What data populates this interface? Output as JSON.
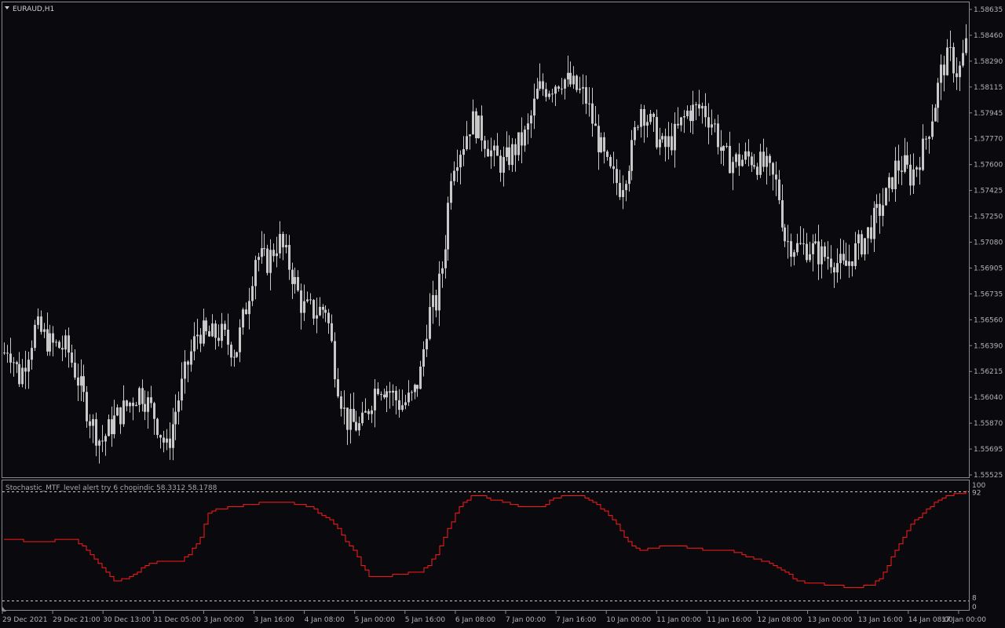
{
  "window": {
    "title": "EURAUD,H1"
  },
  "indicator": {
    "label": "Stochastic_MTF_level alert try 6 chopindic 58.3312 58.1788",
    "levels": [
      {
        "label": "100",
        "value": 100
      },
      {
        "label": "92",
        "value": 92
      },
      {
        "label": "8",
        "value": 8
      },
      {
        "label": "0",
        "value": 0
      }
    ],
    "line_color": "#ff1a1a"
  },
  "colors": {
    "background": "#0a0a0e",
    "candles": "#c8c8c8",
    "grid_frame": "#8a8a8a",
    "axis_text": "#b4b4b4"
  },
  "chart_data": {
    "type": "candlestick",
    "symbol": "EURAUD",
    "timeframe": "H1",
    "ylim": [
      1.5552,
      1.5868
    ],
    "price_ticks": [
      "1.58635",
      "1.58460",
      "1.58290",
      "1.58115",
      "1.57945",
      "1.57770",
      "1.57600",
      "1.57425",
      "1.57250",
      "1.57080",
      "1.56905",
      "1.56735",
      "1.56560",
      "1.56390",
      "1.56215",
      "1.56040",
      "1.55870",
      "1.55695",
      "1.55525"
    ],
    "time_ticks": [
      "29 Dec 2021",
      "29 Dec 21:00",
      "30 Dec 13:00",
      "31 Dec 05:00",
      "3 Jan 00:00",
      "3 Jan 16:00",
      "4 Jan 08:00",
      "5 Jan 00:00",
      "5 Jan 16:00",
      "6 Jan 08:00",
      "7 Jan 00:00",
      "7 Jan 16:00",
      "10 Jan 00:00",
      "11 Jan 00:00",
      "11 Jan 16:00",
      "12 Jan 08:00",
      "13 Jan 00:00",
      "13 Jan 16:00",
      "14 Jan 08:00",
      "17 Jan 00:00"
    ],
    "price_path": [
      [
        0,
        1.563
      ],
      [
        10,
        1.564
      ],
      [
        25,
        1.5618
      ],
      [
        45,
        1.5652
      ],
      [
        65,
        1.564
      ],
      [
        85,
        1.5638
      ],
      [
        100,
        1.5615
      ],
      [
        115,
        1.559
      ],
      [
        128,
        1.5575
      ],
      [
        145,
        1.559
      ],
      [
        162,
        1.56
      ],
      [
        178,
        1.561
      ],
      [
        195,
        1.5595
      ],
      [
        212,
        1.557
      ],
      [
        225,
        1.56
      ],
      [
        240,
        1.563
      ],
      [
        252,
        1.565
      ],
      [
        265,
        1.5645
      ],
      [
        280,
        1.5648
      ],
      [
        300,
        1.5635
      ],
      [
        315,
        1.567
      ],
      [
        325,
        1.57
      ],
      [
        340,
        1.5695
      ],
      [
        355,
        1.571
      ],
      [
        370,
        1.569
      ],
      [
        385,
        1.5665
      ],
      [
        400,
        1.5662
      ],
      [
        415,
        1.5665
      ],
      [
        428,
        1.562
      ],
      [
        440,
        1.559
      ],
      [
        460,
        1.5585
      ],
      [
        480,
        1.5615
      ],
      [
        495,
        1.561
      ],
      [
        510,
        1.56
      ],
      [
        525,
        1.5605
      ],
      [
        535,
        1.562
      ],
      [
        545,
        1.566
      ],
      [
        555,
        1.5668
      ],
      [
        565,
        1.57
      ],
      [
        575,
        1.576
      ],
      [
        590,
        1.5775
      ],
      [
        600,
        1.579
      ],
      [
        615,
        1.578
      ],
      [
        628,
        1.5765
      ],
      [
        640,
        1.576
      ],
      [
        655,
        1.577
      ],
      [
        670,
        1.578
      ],
      [
        685,
        1.581
      ],
      [
        700,
        1.5812
      ],
      [
        715,
        1.5818
      ],
      [
        730,
        1.5812
      ],
      [
        745,
        1.5805
      ],
      [
        760,
        1.5778
      ],
      [
        775,
        1.5755
      ],
      [
        790,
        1.5745
      ],
      [
        805,
        1.577
      ],
      [
        815,
        1.58
      ],
      [
        830,
        1.5785
      ],
      [
        845,
        1.577
      ],
      [
        860,
        1.578
      ],
      [
        875,
        1.5795
      ],
      [
        895,
        1.5798
      ],
      [
        910,
        1.5785
      ],
      [
        920,
        1.5765
      ],
      [
        935,
        1.5762
      ],
      [
        955,
        1.5765
      ],
      [
        975,
        1.5758
      ],
      [
        990,
        1.5745
      ],
      [
        1000,
        1.571
      ],
      [
        1015,
        1.5705
      ],
      [
        1030,
        1.5705
      ],
      [
        1045,
        1.57
      ],
      [
        1060,
        1.5698
      ],
      [
        1075,
        1.569
      ],
      [
        1085,
        1.57
      ],
      [
        1100,
        1.571
      ],
      [
        1115,
        1.5725
      ],
      [
        1130,
        1.574
      ],
      [
        1140,
        1.5758
      ],
      [
        1150,
        1.576
      ],
      [
        1160,
        1.5752
      ],
      [
        1175,
        1.577
      ],
      [
        1190,
        1.58
      ],
      [
        1200,
        1.5825
      ],
      [
        1210,
        1.5832
      ],
      [
        1220,
        1.582
      ],
      [
        1230,
        1.584
      ]
    ],
    "stochastic_path": [
      [
        5,
        55
      ],
      [
        20,
        56
      ],
      [
        35,
        54
      ],
      [
        60,
        54
      ],
      [
        75,
        56
      ],
      [
        95,
        56
      ],
      [
        110,
        46
      ],
      [
        125,
        34
      ],
      [
        135,
        26
      ],
      [
        145,
        18
      ],
      [
        160,
        20
      ],
      [
        175,
        26
      ],
      [
        185,
        32
      ],
      [
        200,
        36
      ],
      [
        230,
        36
      ],
      [
        240,
        42
      ],
      [
        255,
        58
      ],
      [
        265,
        80
      ],
      [
        275,
        84
      ],
      [
        300,
        86
      ],
      [
        320,
        88
      ],
      [
        340,
        90
      ],
      [
        360,
        90
      ],
      [
        380,
        88
      ],
      [
        395,
        86
      ],
      [
        405,
        80
      ],
      [
        420,
        74
      ],
      [
        430,
        66
      ],
      [
        440,
        54
      ],
      [
        450,
        46
      ],
      [
        460,
        32
      ],
      [
        470,
        22
      ],
      [
        495,
        22
      ],
      [
        505,
        24
      ],
      [
        535,
        26
      ],
      [
        545,
        32
      ],
      [
        555,
        42
      ],
      [
        565,
        58
      ],
      [
        575,
        72
      ],
      [
        585,
        86
      ],
      [
        600,
        96
      ],
      [
        615,
        96
      ],
      [
        625,
        92
      ],
      [
        645,
        90
      ],
      [
        660,
        86
      ],
      [
        690,
        86
      ],
      [
        705,
        94
      ],
      [
        720,
        96
      ],
      [
        740,
        96
      ],
      [
        755,
        90
      ],
      [
        770,
        82
      ],
      [
        785,
        70
      ],
      [
        795,
        58
      ],
      [
        805,
        50
      ],
      [
        815,
        46
      ],
      [
        830,
        48
      ],
      [
        845,
        50
      ],
      [
        860,
        50
      ],
      [
        880,
        48
      ],
      [
        900,
        46
      ],
      [
        930,
        46
      ],
      [
        945,
        42
      ],
      [
        960,
        38
      ],
      [
        980,
        34
      ],
      [
        1000,
        26
      ],
      [
        1015,
        18
      ],
      [
        1030,
        16
      ],
      [
        1060,
        14
      ],
      [
        1085,
        12
      ],
      [
        1110,
        14
      ],
      [
        1120,
        20
      ],
      [
        1130,
        32
      ],
      [
        1140,
        46
      ],
      [
        1150,
        58
      ],
      [
        1160,
        70
      ],
      [
        1175,
        80
      ],
      [
        1190,
        90
      ],
      [
        1205,
        96
      ],
      [
        1220,
        98
      ],
      [
        1232,
        100
      ]
    ]
  }
}
